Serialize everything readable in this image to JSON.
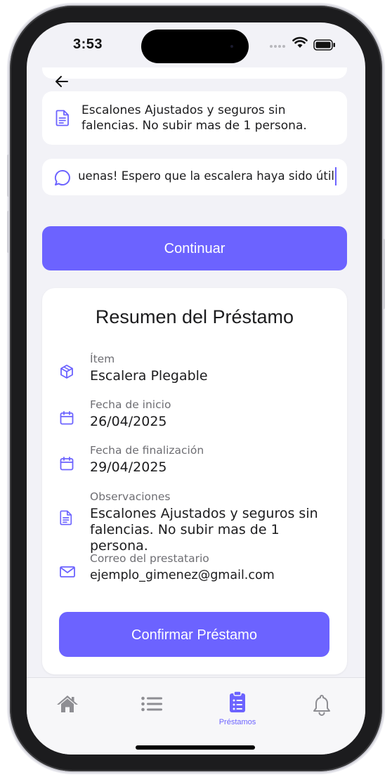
{
  "status_bar": {
    "time": "3:53"
  },
  "form": {
    "observaciones_value": "Escalones Ajustados y seguros sin falencias. No subir mas de 1 persona.",
    "mensaje_value": "Buenas! Espero que la escalera haya sido útil!"
  },
  "buttons": {
    "continue_label": "Continuar",
    "confirm_label": "Confirmar Préstamo"
  },
  "summary": {
    "title": "Resumen del Préstamo",
    "rows": [
      {
        "label": "Ítem",
        "value": "Escalera Plegable",
        "icon": "box-icon"
      },
      {
        "label": "Fecha de inicio",
        "value": "26/04/2025",
        "icon": "calendar-icon"
      },
      {
        "label": "Fecha de finalización",
        "value": "29/04/2025",
        "icon": "calendar-icon"
      },
      {
        "label": "Observaciones",
        "value": "Escalones Ajustados y seguros sin falencias. No subir mas de 1 persona.",
        "icon": "document-icon"
      },
      {
        "label": "Correo del prestatario",
        "value": "ejemplo_gimenez@gmail.com",
        "icon": "mail-icon"
      }
    ]
  },
  "tab_bar": {
    "items": [
      {
        "icon": "home-icon",
        "label": ""
      },
      {
        "icon": "list-icon",
        "label": ""
      },
      {
        "icon": "clipboard-icon",
        "label": "Préstamos",
        "active": true
      },
      {
        "icon": "bell-icon",
        "label": ""
      }
    ]
  },
  "colors": {
    "accent": "#6C63FF",
    "background": "#F2F2F7",
    "card": "#FFFFFF",
    "inactive_icon": "#8E8E93"
  }
}
